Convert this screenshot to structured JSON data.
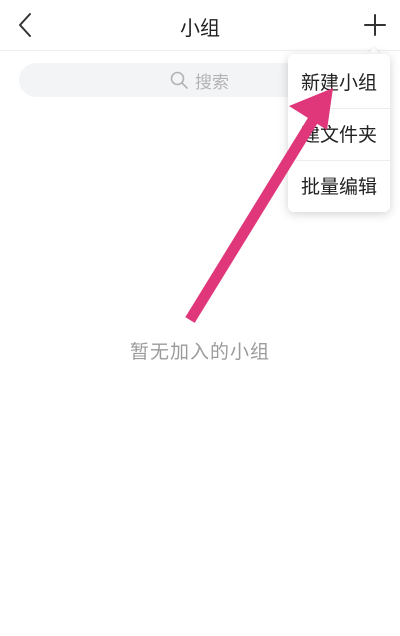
{
  "header": {
    "title": "小组",
    "back_icon": "chevron-left-icon",
    "add_icon": "plus-icon"
  },
  "search": {
    "placeholder": "搜索",
    "icon": "search-icon"
  },
  "empty_state": {
    "message": "暂无加入的小组"
  },
  "dropdown_menu": {
    "items": [
      {
        "label": "新建小组"
      },
      {
        "label": "建文件夹"
      },
      {
        "label": "批量编辑"
      }
    ]
  },
  "annotation": {
    "arrow_color": "#e0367a",
    "points_to": "新建小组"
  },
  "colors": {
    "placeholder_text": "#b3b3b3",
    "empty_text": "#9b9b9b",
    "search_bg": "#f3f4f6"
  }
}
